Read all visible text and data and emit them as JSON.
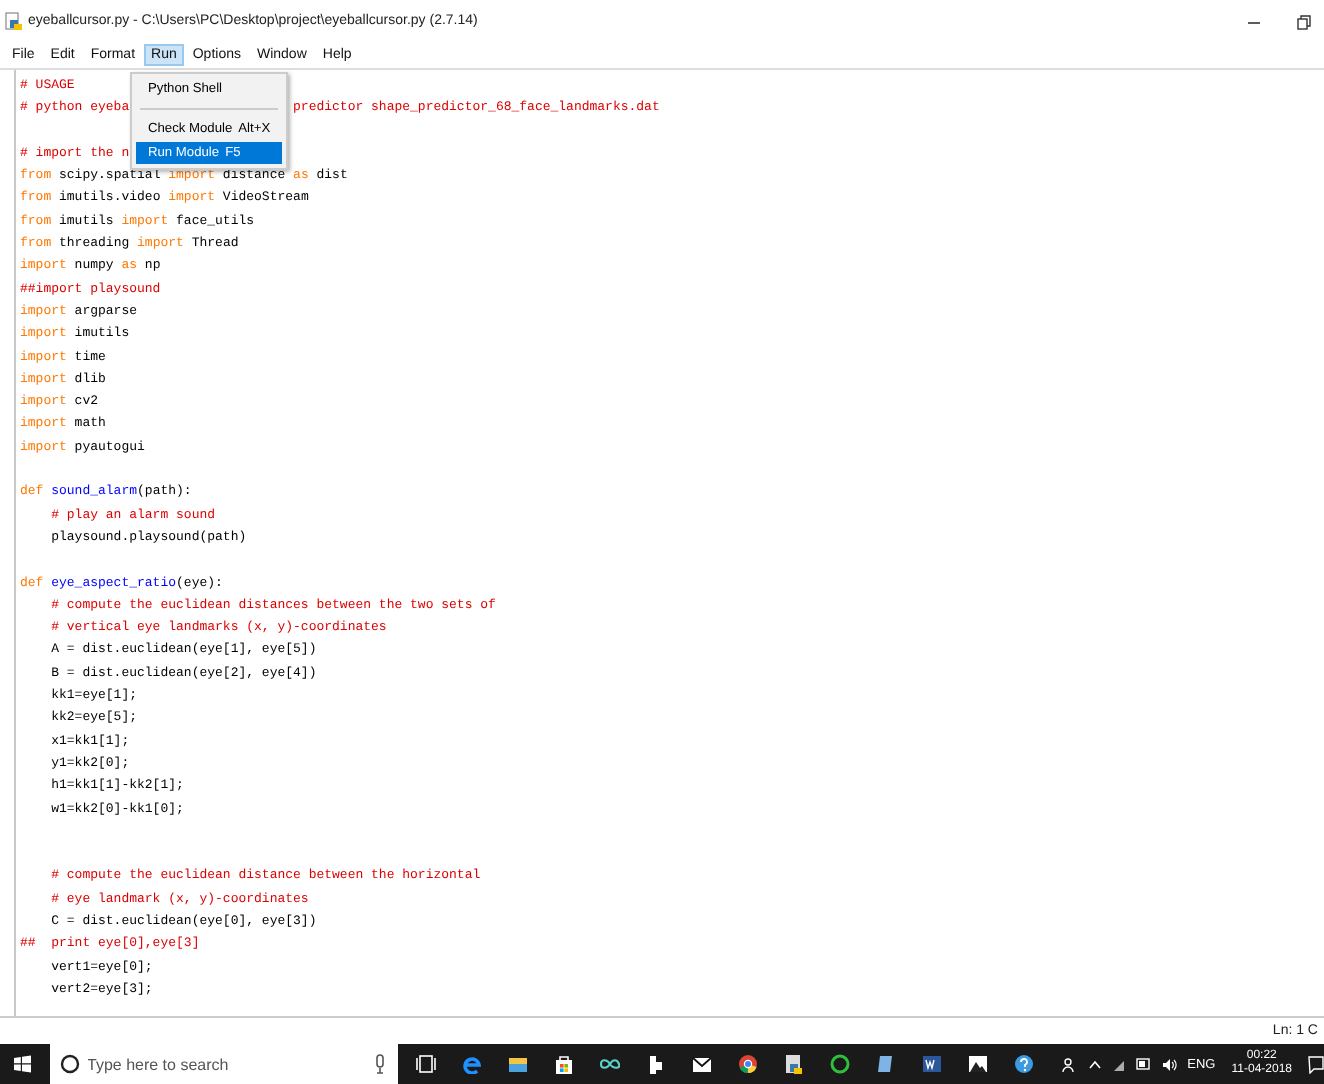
{
  "window": {
    "title": "eyeballcursor.py - C:\\Users\\PC\\Desktop\\project\\eyeballcursor.py (2.7.14)"
  },
  "menu_bar": [
    {
      "label": "File",
      "selected": false
    },
    {
      "label": "Edit",
      "selected": false
    },
    {
      "label": "Format",
      "selected": false
    },
    {
      "label": "Run",
      "selected": true
    },
    {
      "label": "Options",
      "selected": false
    },
    {
      "label": "Window",
      "selected": false
    },
    {
      "label": "Help",
      "selected": false
    }
  ],
  "dropdown": {
    "items": [
      {
        "kind": "item",
        "label": "Python Shell",
        "selected": false
      },
      {
        "kind": "separator"
      },
      {
        "kind": "item",
        "label": "Check Module",
        "shortcut": "Alt+X",
        "selected": false
      },
      {
        "kind": "item",
        "label": "Run Module",
        "shortcut": "F5",
        "selected": true
      }
    ]
  },
  "editor": {
    "lines": [
      {
        "kind": "code",
        "segments": [
          {
            "kind": "comment",
            "t": "# USAGE"
          }
        ]
      },
      {
        "kind": "code",
        "segments": [
          {
            "kind": "comment",
            "t": "# python eyeba"
          },
          {
            "kind": "comment",
            "t": "                     predictor shape_predictor_68_face_landmarks.dat"
          }
        ]
      },
      {
        "kind": "blank"
      },
      {
        "kind": "code",
        "segments": [
          {
            "kind": "comment",
            "t": "# import the n"
          }
        ]
      },
      {
        "kind": "code",
        "segments": [
          {
            "kind": "keyword",
            "t": "from"
          },
          {
            "kind": "plain",
            "t": " scipy.spatial "
          },
          {
            "kind": "keyword",
            "t": "import"
          },
          {
            "kind": "plain",
            "t": " distance "
          },
          {
            "kind": "keyword",
            "t": "as"
          },
          {
            "kind": "plain",
            "t": " dist"
          }
        ]
      },
      {
        "kind": "code",
        "segments": [
          {
            "kind": "keyword",
            "t": "from"
          },
          {
            "kind": "plain",
            "t": " imutils.video "
          },
          {
            "kind": "keyword",
            "t": "import"
          },
          {
            "kind": "plain",
            "t": " VideoStream"
          }
        ]
      },
      {
        "kind": "code",
        "segments": [
          {
            "kind": "keyword",
            "t": "from"
          },
          {
            "kind": "plain",
            "t": " imutils "
          },
          {
            "kind": "keyword",
            "t": "import"
          },
          {
            "kind": "plain",
            "t": " face_utils"
          }
        ]
      },
      {
        "kind": "code",
        "segments": [
          {
            "kind": "keyword",
            "t": "from"
          },
          {
            "kind": "plain",
            "t": " threading "
          },
          {
            "kind": "keyword",
            "t": "import"
          },
          {
            "kind": "plain",
            "t": " Thread"
          }
        ]
      },
      {
        "kind": "code",
        "segments": [
          {
            "kind": "keyword",
            "t": "import"
          },
          {
            "kind": "plain",
            "t": " numpy "
          },
          {
            "kind": "keyword",
            "t": "as"
          },
          {
            "kind": "plain",
            "t": " np"
          }
        ]
      },
      {
        "kind": "code",
        "segments": [
          {
            "kind": "comment",
            "t": "##import playsound"
          }
        ]
      },
      {
        "kind": "code",
        "segments": [
          {
            "kind": "keyword",
            "t": "import"
          },
          {
            "kind": "plain",
            "t": " argparse"
          }
        ]
      },
      {
        "kind": "code",
        "segments": [
          {
            "kind": "keyword",
            "t": "import"
          },
          {
            "kind": "plain",
            "t": " imutils"
          }
        ]
      },
      {
        "kind": "code",
        "segments": [
          {
            "kind": "keyword",
            "t": "import"
          },
          {
            "kind": "plain",
            "t": " time"
          }
        ]
      },
      {
        "kind": "code",
        "segments": [
          {
            "kind": "keyword",
            "t": "import"
          },
          {
            "kind": "plain",
            "t": " dlib"
          }
        ]
      },
      {
        "kind": "code",
        "segments": [
          {
            "kind": "keyword",
            "t": "import"
          },
          {
            "kind": "plain",
            "t": " cv2"
          }
        ]
      },
      {
        "kind": "code",
        "segments": [
          {
            "kind": "keyword",
            "t": "import"
          },
          {
            "kind": "plain",
            "t": " math"
          }
        ]
      },
      {
        "kind": "code",
        "segments": [
          {
            "kind": "keyword",
            "t": "import"
          },
          {
            "kind": "plain",
            "t": " pyautogui"
          }
        ]
      },
      {
        "kind": "blank"
      },
      {
        "kind": "code",
        "segments": [
          {
            "kind": "keyword",
            "t": "def"
          },
          {
            "kind": "defname",
            "t": " sound_alarm"
          },
          {
            "kind": "plain",
            "t": "(path):"
          }
        ]
      },
      {
        "kind": "code",
        "segments": [
          {
            "kind": "comment",
            "t": "    # play an alarm sound"
          }
        ]
      },
      {
        "kind": "code",
        "segments": [
          {
            "kind": "plain",
            "t": "    playsound.playsound(path)"
          }
        ]
      },
      {
        "kind": "blank"
      },
      {
        "kind": "code",
        "segments": [
          {
            "kind": "keyword",
            "t": "def"
          },
          {
            "kind": "defname",
            "t": " eye_aspect_ratio"
          },
          {
            "kind": "plain",
            "t": "(eye):"
          }
        ]
      },
      {
        "kind": "code",
        "segments": [
          {
            "kind": "comment",
            "t": "    # compute the euclidean distances between the two sets of"
          }
        ]
      },
      {
        "kind": "code",
        "segments": [
          {
            "kind": "comment",
            "t": "    # vertical eye landmarks (x, y)-coordinates"
          }
        ]
      },
      {
        "kind": "code",
        "segments": [
          {
            "kind": "plain",
            "t": "    A = dist.euclidean(eye[1], eye[5])"
          }
        ]
      },
      {
        "kind": "code",
        "segments": [
          {
            "kind": "plain",
            "t": "    B = dist.euclidean(eye[2], eye[4])"
          }
        ]
      },
      {
        "kind": "code",
        "segments": [
          {
            "kind": "plain",
            "t": "    kk1=eye[1];"
          }
        ]
      },
      {
        "kind": "code",
        "segments": [
          {
            "kind": "plain",
            "t": "    kk2=eye[5];"
          }
        ]
      },
      {
        "kind": "code",
        "segments": [
          {
            "kind": "plain",
            "t": "    x1=kk1[1];"
          }
        ]
      },
      {
        "kind": "code",
        "segments": [
          {
            "kind": "plain",
            "t": "    y1=kk2[0];"
          }
        ]
      },
      {
        "kind": "code",
        "segments": [
          {
            "kind": "plain",
            "t": "    h1=kk1[1]-kk2[1];"
          }
        ]
      },
      {
        "kind": "code",
        "segments": [
          {
            "kind": "plain",
            "t": "    w1=kk2[0]-kk1[0];"
          }
        ]
      },
      {
        "kind": "blank"
      },
      {
        "kind": "blank"
      },
      {
        "kind": "code",
        "segments": [
          {
            "kind": "comment",
            "t": "    # compute the euclidean distance between the horizontal"
          }
        ]
      },
      {
        "kind": "code",
        "segments": [
          {
            "kind": "comment",
            "t": "    # eye landmark (x, y)-coordinates"
          }
        ]
      },
      {
        "kind": "code",
        "segments": [
          {
            "kind": "plain",
            "t": "    C = dist.euclidean(eye[0], eye[3])"
          }
        ]
      },
      {
        "kind": "code",
        "segments": [
          {
            "kind": "comment",
            "t": "##  print eye[0],eye[3]"
          }
        ]
      },
      {
        "kind": "code",
        "segments": [
          {
            "kind": "plain",
            "t": "    vert1=eye[0];"
          }
        ]
      },
      {
        "kind": "code",
        "segments": [
          {
            "kind": "plain",
            "t": "    vert2=eye[3];"
          }
        ]
      }
    ]
  },
  "status_bar": {
    "position": "Ln: 1 C"
  },
  "taskbar": {
    "search_placeholder": "Type here to search",
    "language": "ENG",
    "time": "00:22",
    "date": "11-04-2018"
  }
}
